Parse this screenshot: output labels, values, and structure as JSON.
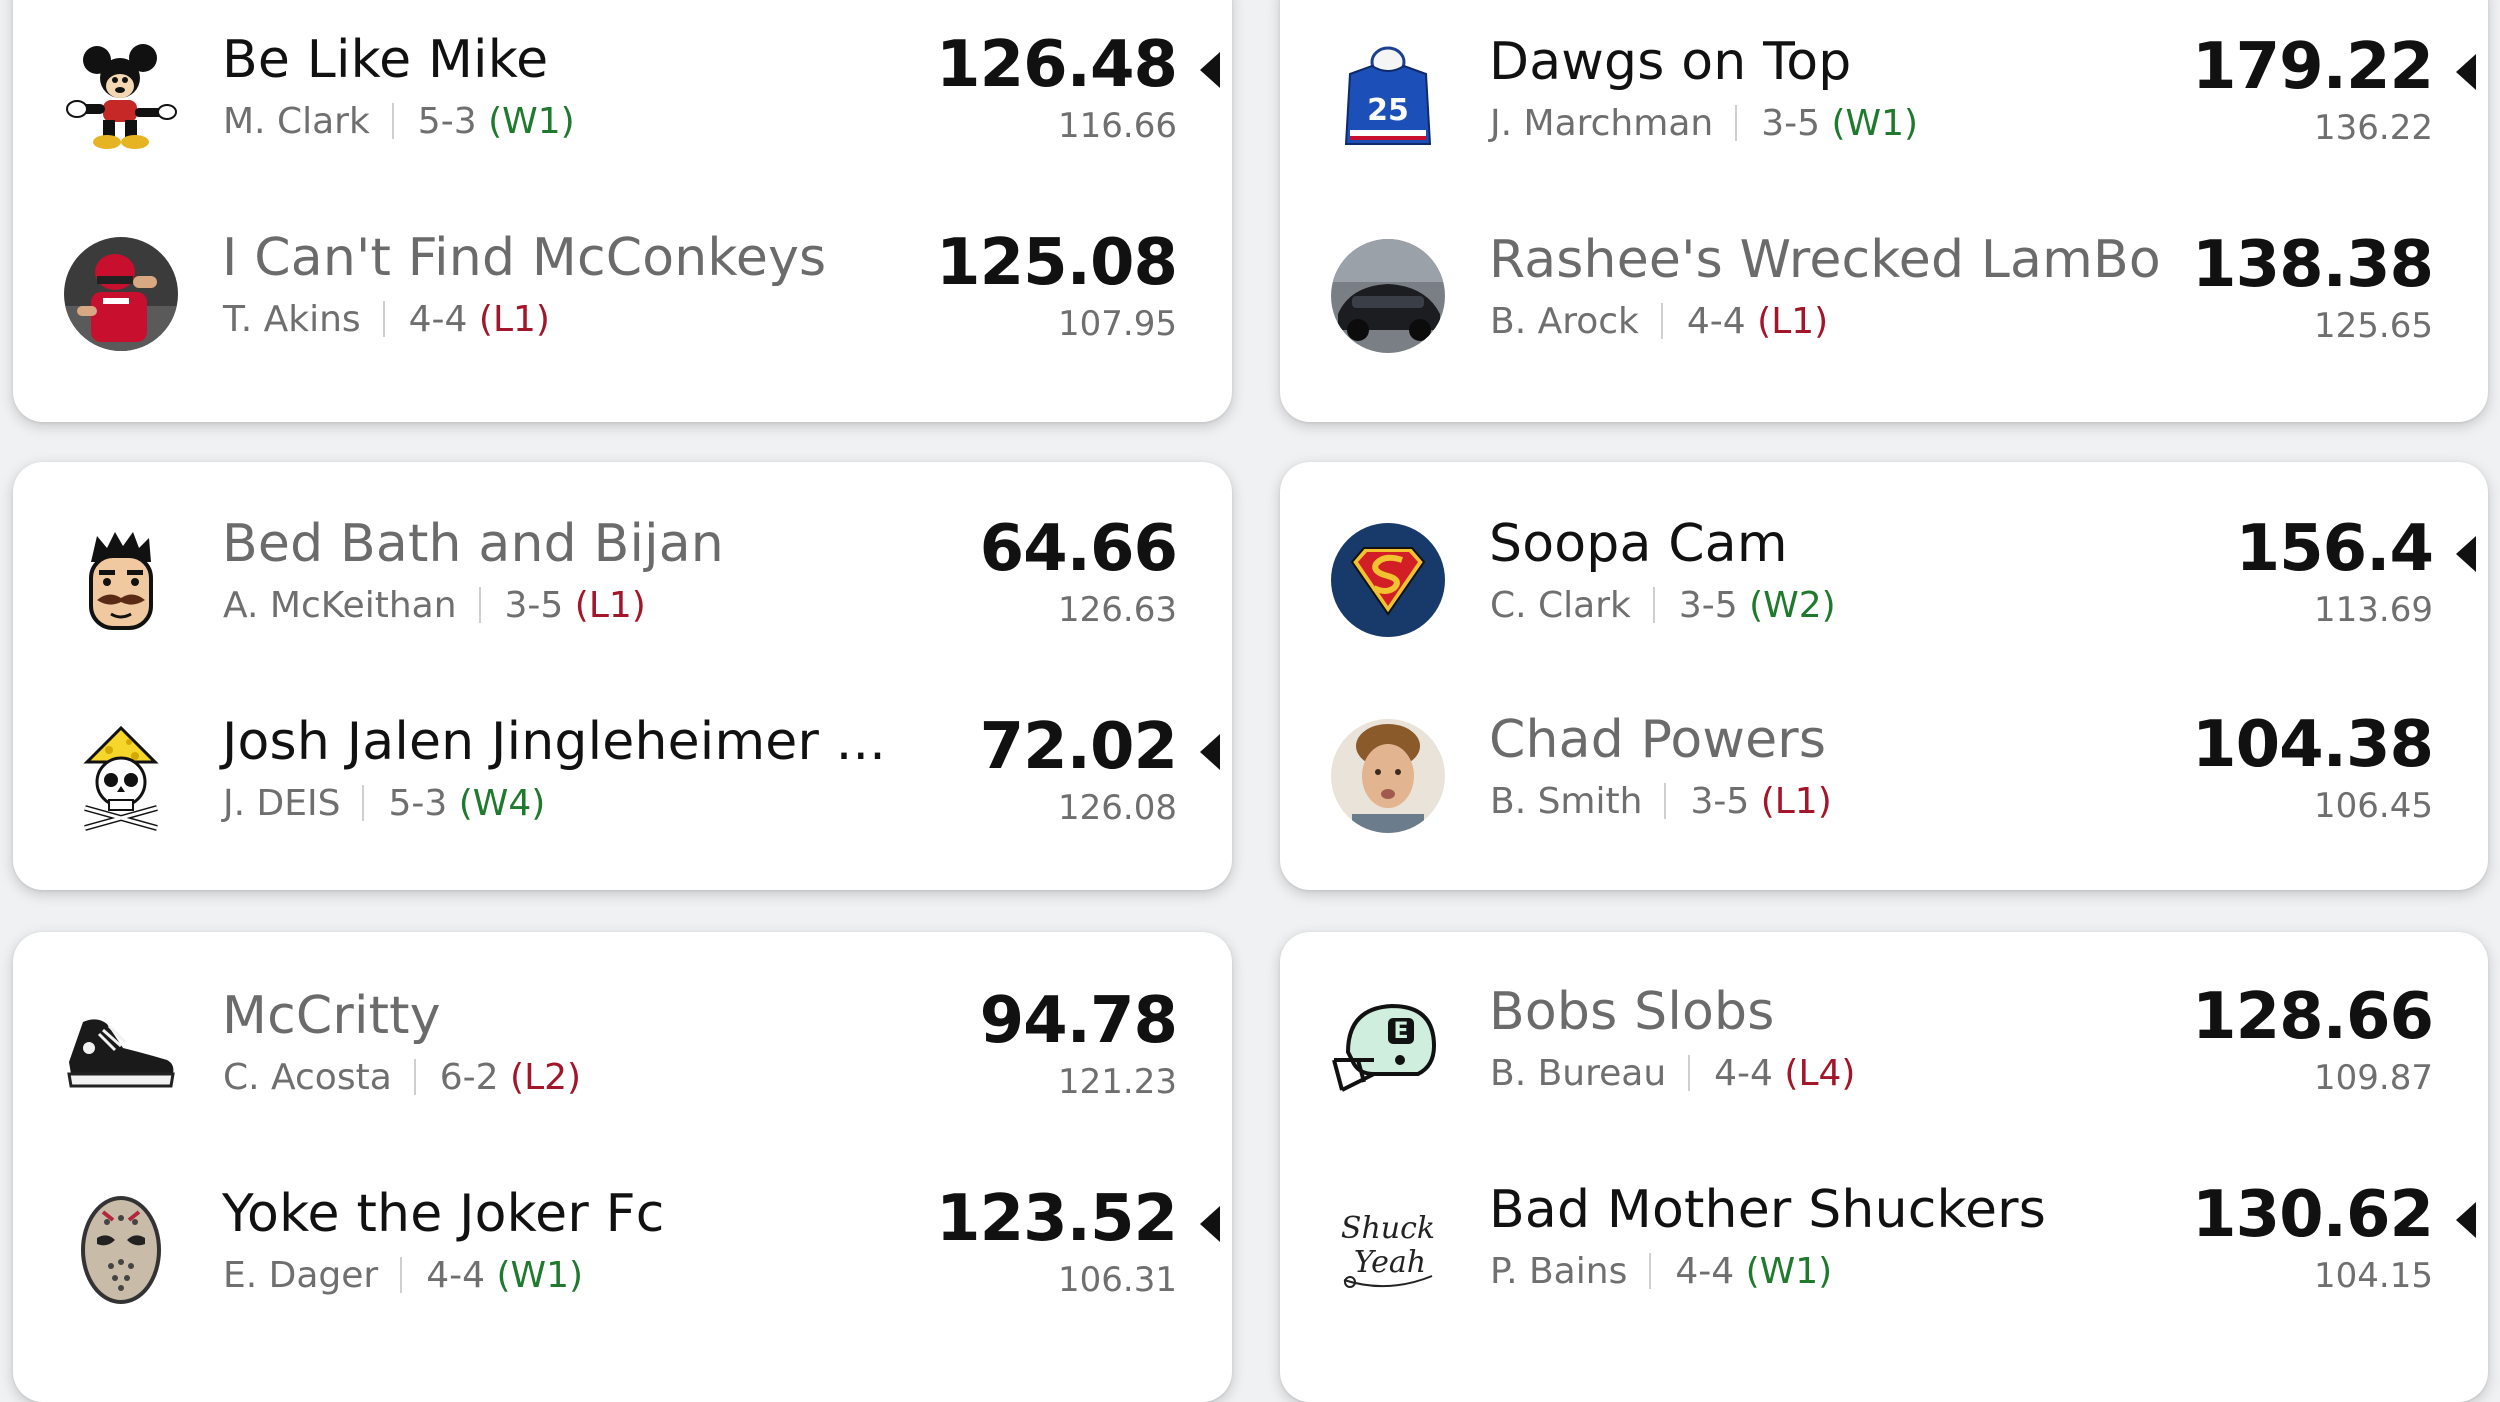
{
  "matchups": [
    {
      "teams": [
        {
          "name": "Be Like Mike",
          "owner": "M. Clark",
          "record": "5-3",
          "streak": "(W1)",
          "score": "126.48",
          "projected": "116.66",
          "winner": true,
          "avatar": "mickey-mouse-icon"
        },
        {
          "name": "I Can't Find McConkeys",
          "owner": "T. Akins",
          "record": "4-4",
          "streak": "(L1)",
          "score": "125.08",
          "projected": "107.95",
          "winner": false,
          "avatar": "football-player-photo-icon"
        }
      ]
    },
    {
      "teams": [
        {
          "name": "Dawgs on Top",
          "owner": "J. Marchman",
          "record": "3-5",
          "streak": "(W1)",
          "score": "179.22",
          "projected": "136.22",
          "winner": true,
          "avatar": "jersey-25-icon"
        },
        {
          "name": "Rashee's Wrecked LamBo",
          "owner": "B. Arock",
          "record": "4-4",
          "streak": "(L1)",
          "score": "138.38",
          "projected": "125.65",
          "winner": false,
          "avatar": "car-photo-icon"
        }
      ]
    },
    {
      "teams": [
        {
          "name": "Bed Bath and Bijan",
          "owner": "A. McKeithan",
          "record": "3-5",
          "streak": "(L1)",
          "score": "64.66",
          "projected": "126.63",
          "winner": false,
          "avatar": "mustache-face-icon"
        },
        {
          "name": "Josh Jalen Jingleheimer ...",
          "owner": "J. DEIS",
          "record": "5-3",
          "streak": "(W4)",
          "score": "72.02",
          "projected": "126.08",
          "winner": true,
          "avatar": "skull-cheese-hat-icon"
        }
      ]
    },
    {
      "teams": [
        {
          "name": "Soopa Cam",
          "owner": "C. Clark",
          "record": "3-5",
          "streak": "(W2)",
          "score": "156.4",
          "projected": "113.69",
          "winner": true,
          "avatar": "superman-shield-icon"
        },
        {
          "name": "Chad Powers",
          "owner": "B. Smith",
          "record": "3-5",
          "streak": "(L1)",
          "score": "104.38",
          "projected": "106.45",
          "winner": false,
          "avatar": "man-face-photo-icon"
        }
      ]
    },
    {
      "teams": [
        {
          "name": "McCritty",
          "owner": "C. Acosta",
          "record": "6-2",
          "streak": "(L2)",
          "score": "94.78",
          "projected": "121.23",
          "winner": false,
          "avatar": "sneaker-icon"
        },
        {
          "name": "Yoke the Joker Fc",
          "owner": "E. Dager",
          "record": "4-4",
          "streak": "(W1)",
          "score": "123.52",
          "projected": "106.31",
          "winner": true,
          "avatar": "hockey-mask-icon"
        }
      ]
    },
    {
      "teams": [
        {
          "name": "Bobs Slobs",
          "owner": "B. Bureau",
          "record": "4-4",
          "streak": "(L4)",
          "score": "128.66",
          "projected": "109.87",
          "winner": false,
          "avatar": "espn-helmet-icon"
        },
        {
          "name": "Bad Mother Shuckers",
          "owner": "P. Bains",
          "record": "4-4",
          "streak": "(W1)",
          "score": "130.62",
          "projected": "104.15",
          "winner": true,
          "avatar": "shuck-yeah-script-icon"
        }
      ]
    }
  ],
  "colors": {
    "winner_text": "#111111",
    "loser_text": "#6b6b6b",
    "win_streak": "#1f7a2e",
    "loss_streak": "#a3162a"
  },
  "avatar_texts": {
    "jersey_number": "25",
    "espn_letter": "E",
    "shuck_script_line1": "Shuck",
    "shuck_script_line2": "Yeah"
  }
}
